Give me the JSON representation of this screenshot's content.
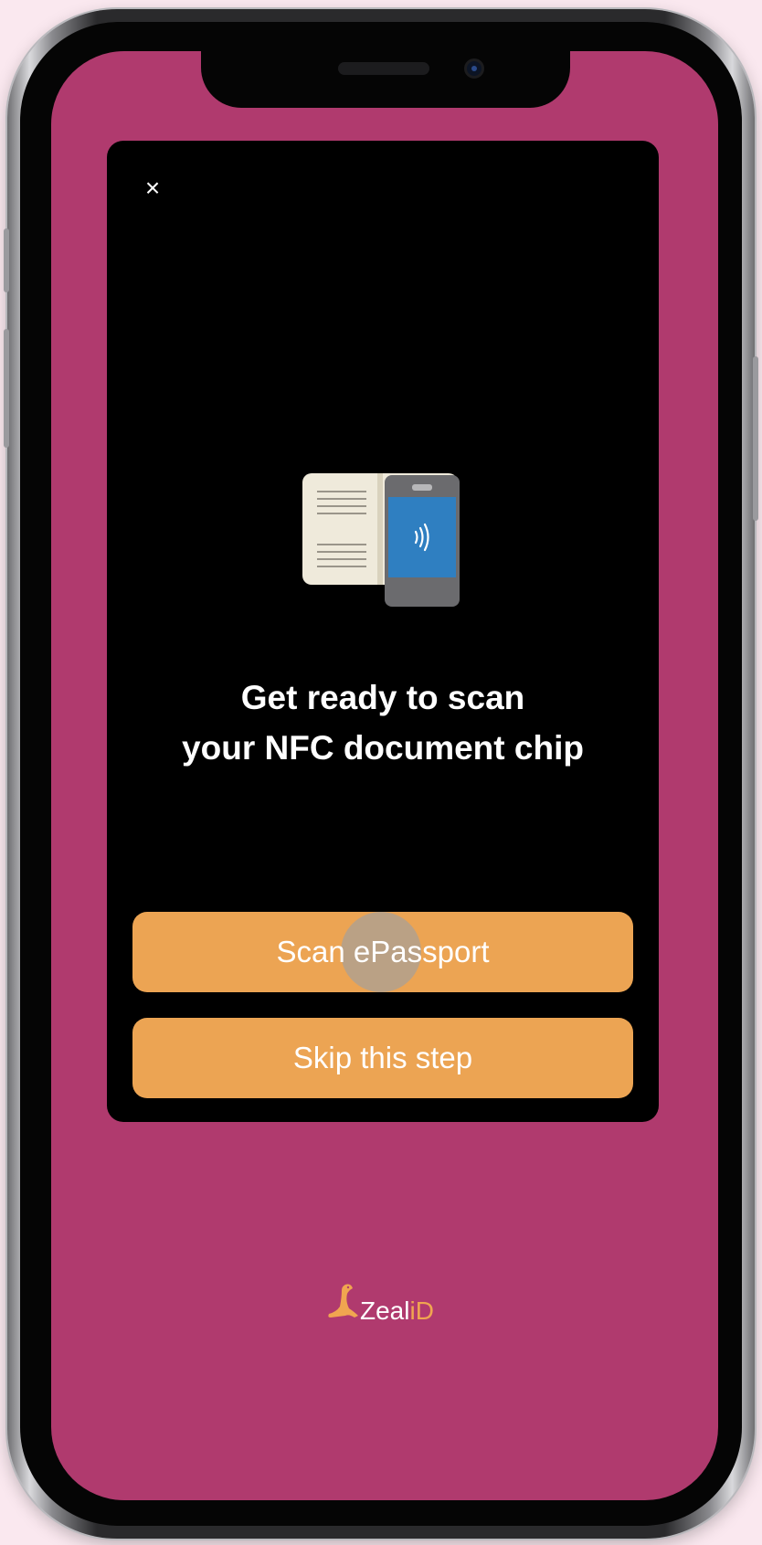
{
  "modal": {
    "close_symbol": "×",
    "illustration_icon": "passport-nfc-phone-icon",
    "headline_line1": "Get ready to scan",
    "headline_line2": "your NFC document chip",
    "scan_button_label": "Scan ePassport",
    "skip_button_label": "Skip this step"
  },
  "brand": {
    "name_part1": "Zeal",
    "name_part2": "iD",
    "logo_icon": "seal-logo-icon"
  },
  "colors": {
    "screen_background": "#b03a6e",
    "modal_background": "#000000",
    "button_background": "#eca453",
    "brand_accent": "#f0a550",
    "phone_screen_blue": "#2f7fc1"
  }
}
